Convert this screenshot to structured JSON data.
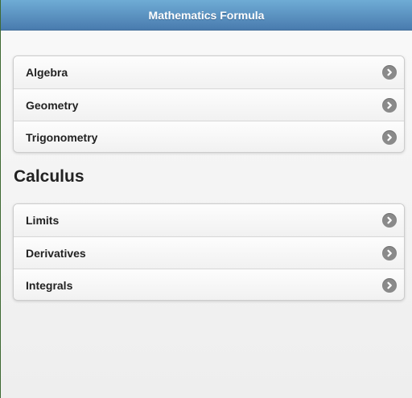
{
  "header": {
    "title": "Mathematics Formula"
  },
  "list1": {
    "items": [
      {
        "label": "Algebra",
        "icon": "chevron-right-icon"
      },
      {
        "label": "Geometry",
        "icon": "chevron-right-icon"
      },
      {
        "label": "Trigonometry",
        "icon": "chevron-right-icon"
      }
    ]
  },
  "section": {
    "title": "Calculus"
  },
  "list2": {
    "items": [
      {
        "label": "Limits",
        "icon": "chevron-right-icon"
      },
      {
        "label": "Derivatives",
        "icon": "chevron-right-icon"
      },
      {
        "label": "Integrals",
        "icon": "chevron-right-icon"
      }
    ]
  },
  "colors": {
    "header_top": "#6facd5",
    "header_bottom": "#497bae",
    "arrow": "#8a8a8a"
  }
}
